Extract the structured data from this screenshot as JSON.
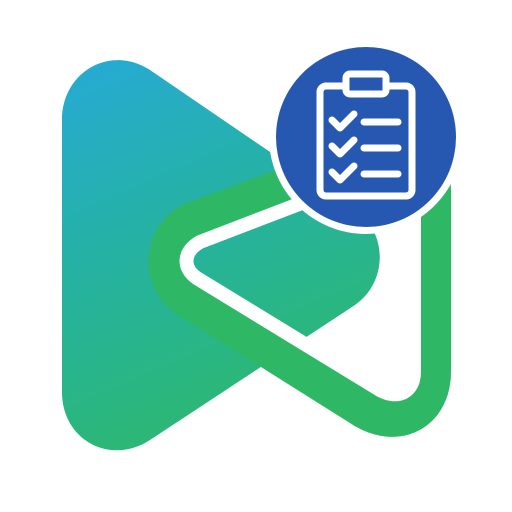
{
  "icon": {
    "name": "app-logo-with-checklist",
    "logo_shape": "play-triangle-mark",
    "badge_icon": "clipboard-checklist-icon"
  },
  "colors": {
    "gradient_top": "#26AAD6",
    "gradient_mid": "#25B2A2",
    "gradient_bottom": "#2DB871",
    "outline": "#2EB866",
    "badge_bg": "#2658B1",
    "badge_border": "#ffffff",
    "clipboard_stroke": "#ffffff",
    "background": "#ffffff"
  },
  "checklist": {
    "items_checked": [
      true,
      true,
      true
    ]
  }
}
